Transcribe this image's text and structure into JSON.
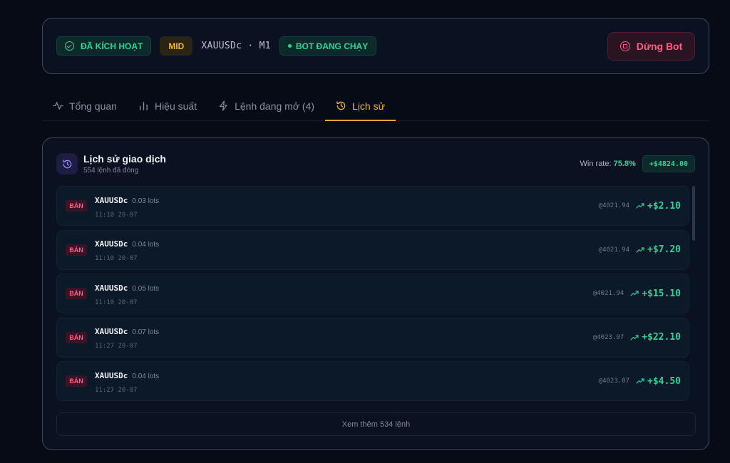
{
  "status": {
    "active_label": "ĐÃ KÍCH HOẠT",
    "mode_label": "MID",
    "symbol_label": "XAUUSDc · M1",
    "running_label": "BOT ĐANG CHẠY",
    "stop_label": "Dừng Bot"
  },
  "tabs": [
    {
      "label": "Tổng quan",
      "icon": "activity-icon"
    },
    {
      "label": "Hiệu suất",
      "icon": "bar-chart-icon"
    },
    {
      "label": "Lệnh đang mở (4)",
      "icon": "lightning-icon"
    },
    {
      "label": "Lịch sử",
      "icon": "history-icon",
      "active": true
    }
  ],
  "history": {
    "title": "Lịch sử giao dịch",
    "subtitle": "554 lệnh đã đóng",
    "winrate_label": "Win rate:",
    "winrate_value": "75.8%",
    "total_pnl": "+$4824.00",
    "rows": [
      {
        "side": "BÁN",
        "symbol": "XAUUSDc",
        "lots": "0.03 lots",
        "time": "11:10 20-07",
        "price": "@4021.94",
        "pnl": "+$2.10"
      },
      {
        "side": "BÁN",
        "symbol": "XAUUSDc",
        "lots": "0.04 lots",
        "time": "11:10 20-07",
        "price": "@4021.94",
        "pnl": "+$7.20"
      },
      {
        "side": "BÁN",
        "symbol": "XAUUSDc",
        "lots": "0.05 lots",
        "time": "11:10 20-07",
        "price": "@4021.94",
        "pnl": "+$15.10"
      },
      {
        "side": "BÁN",
        "symbol": "XAUUSDc",
        "lots": "0.07 lots",
        "time": "11:27 20-07",
        "price": "@4023.07",
        "pnl": "+$22.10"
      },
      {
        "side": "BÁN",
        "symbol": "XAUUSDc",
        "lots": "0.04 lots",
        "time": "11:27 20-07",
        "price": "@4023.07",
        "pnl": "+$4.50"
      }
    ],
    "more_label": "Xem thêm 534 lệnh"
  },
  "colors": {
    "accent": "#f2b531",
    "profit": "#2fd39a",
    "sell": "#ff5c84",
    "background": "#070b16"
  }
}
